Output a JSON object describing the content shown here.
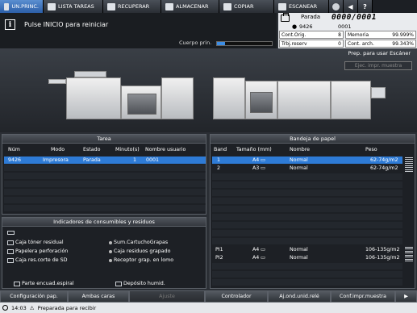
{
  "nav": {
    "tabs": [
      {
        "label": "UN.PRINC.",
        "icon": "home-icon",
        "active": true
      },
      {
        "label": "LISTA TAREAS",
        "icon": "job-list-icon"
      },
      {
        "label": "RECUPERAR",
        "icon": "recall-icon"
      },
      {
        "label": "ALMACENAR",
        "icon": "store-icon"
      },
      {
        "label": "COPIAR",
        "icon": "copy-icon"
      },
      {
        "label": "ESCANEAR",
        "icon": "scan-icon"
      }
    ],
    "extra_icons": [
      "settings-icon",
      "volume-icon",
      "help-icon"
    ],
    "help_label": "?"
  },
  "message": {
    "icon": "info-icon",
    "icon_glyph": "i",
    "text": "Pulse INICIO para reiniciar",
    "cuerpo_label": "Cuerpo prin.",
    "cuerpo_level": 0.15
  },
  "status": {
    "state": "Parada",
    "counter": "0000/0001",
    "job_id": "9426",
    "job_num": "0001",
    "cont_orig_label": "Cont.Orig.",
    "cont_orig_value": "8",
    "memoria_label": "Memoria",
    "memoria_value": "99.999%",
    "trbj_reserv_label": "Trbj.reserv",
    "trbj_reserv_value": "0",
    "cont_arch_label": "Cont. arch.",
    "cont_arch_value": "99.343%"
  },
  "machine": {
    "ready_text": "Prep. para usar Escáner",
    "ejec_button": "Ejec. impr. muestra"
  },
  "tarea": {
    "title": "Tarea",
    "columns": [
      "Núm",
      "Modo",
      "Estado",
      "Minuto(s)",
      "Nombre usuario"
    ],
    "rows": [
      {
        "num": "9426",
        "modo": "Impresora",
        "estado": "Parada",
        "minutos": "1",
        "usuario": "0001"
      }
    ]
  },
  "bandeja": {
    "title": "Bandeja de papel",
    "columns": [
      "Band",
      "Tamaño (mm)",
      "Nombre",
      "Peso"
    ],
    "rows": [
      {
        "band": "1",
        "tamano": "A4",
        "nombre": "Normal",
        "peso": "62-74g/m2",
        "selected": true
      },
      {
        "band": "2",
        "tamano": "A3",
        "nombre": "Normal",
        "peso": "62-74g/m2"
      },
      {
        "band": "PI1",
        "tamano": "A4",
        "nombre": "Normal",
        "peso": "106-135g/m2"
      },
      {
        "band": "PI2",
        "tamano": "A4",
        "nombre": "Normal",
        "peso": "106-135g/m2"
      }
    ]
  },
  "consumibles": {
    "title": "Indicadores de consumibles y residuos",
    "left": [
      {
        "label": "Caja tóner residual",
        "icon": "toner-box-icon"
      },
      {
        "label": "Papelera perforación",
        "icon": "punch-bin-icon"
      },
      {
        "label": "Caja res.corte de SD",
        "icon": "trim-box-icon"
      }
    ],
    "right": [
      {
        "label": "Sum.CartuchoGrapas",
        "icon": "staple-cartridge-icon"
      },
      {
        "label": "Caja residuos grapado",
        "icon": "staple-waste-icon"
      },
      {
        "label": "Receptor grap. en lomo",
        "icon": "spine-stapler-icon"
      }
    ],
    "bottom_left": {
      "label": "Parte encuad.espiral",
      "icon": "spiral-bind-icon"
    },
    "bottom_right": {
      "label": "Depósito humid.",
      "icon": "humid-tank-icon"
    }
  },
  "bottom_tabs": [
    {
      "label": "Configuración pap.",
      "enabled": true
    },
    {
      "label": "Ambas caras",
      "enabled": true
    },
    {
      "label": "Ajuste",
      "enabled": false
    },
    {
      "label": "Controlador",
      "enabled": true
    },
    {
      "label": "Aj.ond.unid.relé",
      "enabled": true
    },
    {
      "label": "Conf.impr.muestra",
      "enabled": true
    }
  ],
  "statusbar": {
    "time": "14:03",
    "text": "Preparada para recibir"
  },
  "colors": {
    "accent": "#2e7bd6",
    "panel": "#1d2025",
    "header_active": "#3a72c0"
  }
}
